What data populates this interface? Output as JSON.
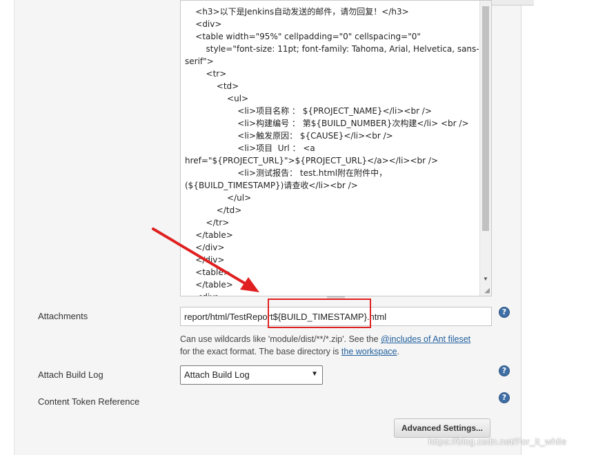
{
  "editor": {
    "lines": [
      "    <h3>以下是Jenkins自动发送的邮件，请勿回复！</h3>",
      "    <div>",
      "    <table width=\"95%\" cellpadding=\"0\" cellspacing=\"0\"",
      "        style=\"font-size: 11pt; font-family: Tahoma, Arial, Helvetica, sans-",
      "serif\">",
      "        <tr>",
      "            <td>",
      "                <ul>",
      "                    <li>项目名称 ： ${PROJECT_NAME}</li><br />",
      "                    <li>构建编号 ： 第${BUILD_NUMBER}次构建</li> <br />",
      "                    <li>触发原因： ${CAUSE}</li><br />",
      "                    <li>项目  Url ： <a",
      "href=\"${PROJECT_URL}\">${PROJECT_URL}</a></li><br />",
      "                    <li>测试报告： test.html附在附件中，",
      "(${BUILD_TIMESTAMP})请查收</li><br />",
      "                </ul>",
      "            </td>",
      "        </tr>",
      "    </table>",
      "    </div>",
      "    </div>",
      "    <table>",
      "    </table>",
      "    <div>"
    ]
  },
  "attachments": {
    "label": "Attachments",
    "value": "report/html/TestReport${BUILD_TIMESTAMP}.html",
    "hint_before": "Can use wildcards like 'module/dist/**/*.zip'. See the ",
    "hint_link1": "@includes of Ant fileset",
    "hint_middle": " for the exact format. The base directory is ",
    "hint_link2": "the workspace",
    "hint_after": "."
  },
  "attach_build_log": {
    "label": "Attach Build Log",
    "selected": "Attach Build Log"
  },
  "content_token": {
    "label": "Content Token Reference"
  },
  "help_icon_text": "?",
  "advanced_button": "Advanced Settings...",
  "watermark": "https://blog.csdn.net/For_it_while",
  "colors": {
    "annotation": "#e02020",
    "link": "#1e5e9c",
    "help": "#3f6fa5"
  }
}
